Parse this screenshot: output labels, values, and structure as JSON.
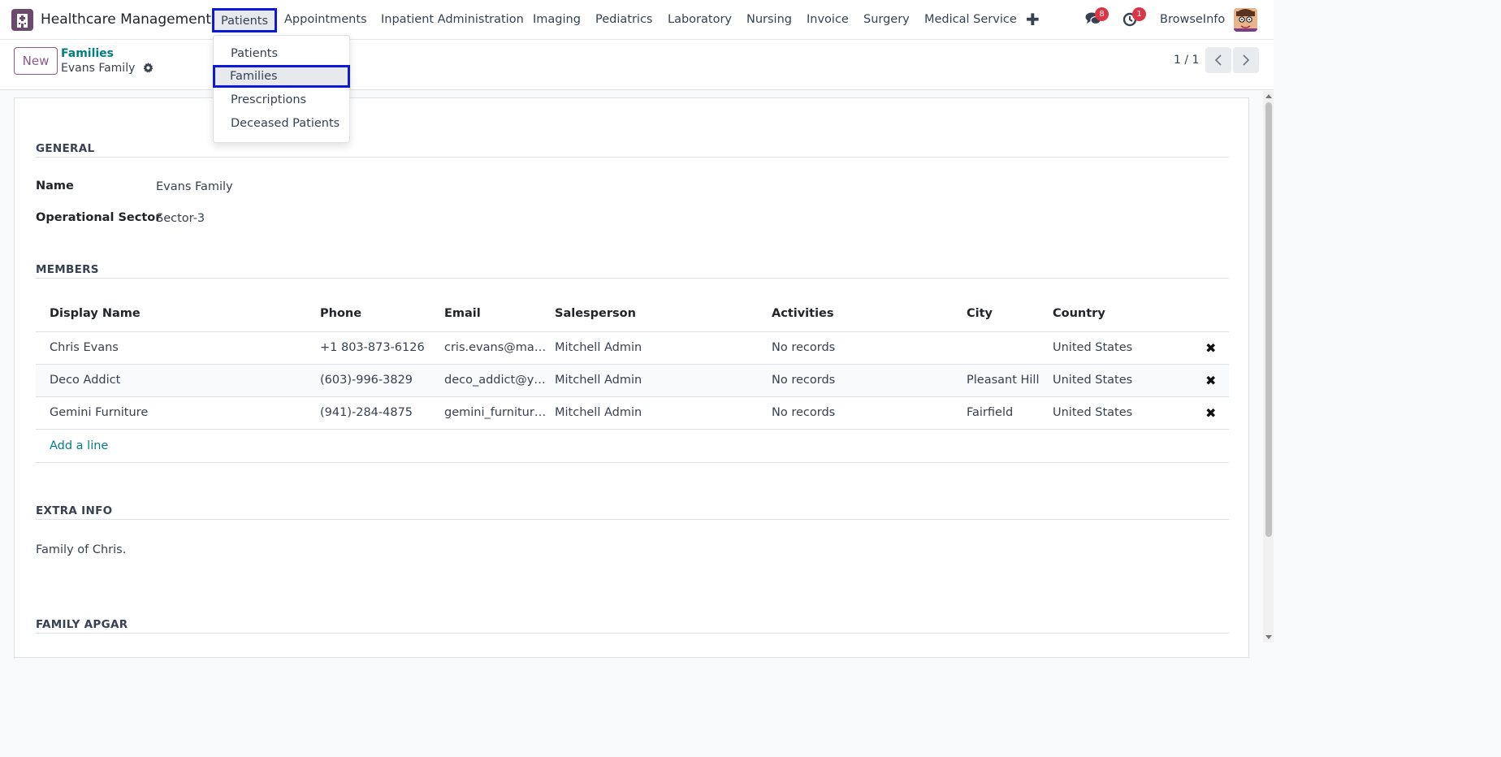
{
  "navbar": {
    "app_title": "Healthcare Management",
    "menus": [
      "Patients",
      "Appointments",
      "Inpatient Administration",
      "Imaging",
      "Pediatrics",
      "Laboratory",
      "Nursing",
      "Invoice",
      "Surgery",
      "Medical Service"
    ],
    "plus_icon": "plus-icon",
    "messages_badge": "8",
    "activities_badge": "1",
    "company": "BrowseInfo"
  },
  "control": {
    "new_label": "New",
    "breadcrumb_parent": "Families",
    "breadcrumb_current": "Evans Family",
    "pager": "1 / 1"
  },
  "dropdown": {
    "items": [
      "Patients",
      "Families",
      "Prescriptions",
      "Deceased Patients"
    ],
    "highlighted": "Families"
  },
  "form": {
    "general_title": "GENERAL",
    "name_label": "Name",
    "name_value": "Evans Family",
    "sector_label": "Operational Sector",
    "sector_value": "Sector-3",
    "members_title": "MEMBERS",
    "columns": [
      "Display Name",
      "Phone",
      "Email",
      "Salesperson",
      "Activities",
      "City",
      "Country"
    ],
    "rows": [
      {
        "name": "Chris Evans",
        "phone": "+1 803-873-6126",
        "email": "cris.evans@mail…",
        "salesperson": "Mitchell Admin",
        "activities": "No records",
        "city": "",
        "country": "United States"
      },
      {
        "name": "Deco Addict",
        "phone": "(603)-996-3829",
        "email": "deco_addict@y…",
        "salesperson": "Mitchell Admin",
        "activities": "No records",
        "city": "Pleasant Hill",
        "country": "United States"
      },
      {
        "name": "Gemini Furniture",
        "phone": "(941)-284-4875",
        "email": "gemini_furnitur…",
        "salesperson": "Mitchell Admin",
        "activities": "No records",
        "city": "Fairfield",
        "country": "United States"
      }
    ],
    "add_line": "Add a line",
    "extra_title": "EXTRA INFO",
    "extra_text": "Family of Chris.",
    "apgar_title": "FAMILY APGAR"
  },
  "colors": {
    "accent": "#017e84",
    "brand": "#8d5a85",
    "highlight_border": "#0a1ad8",
    "badge": "#dc3545"
  }
}
